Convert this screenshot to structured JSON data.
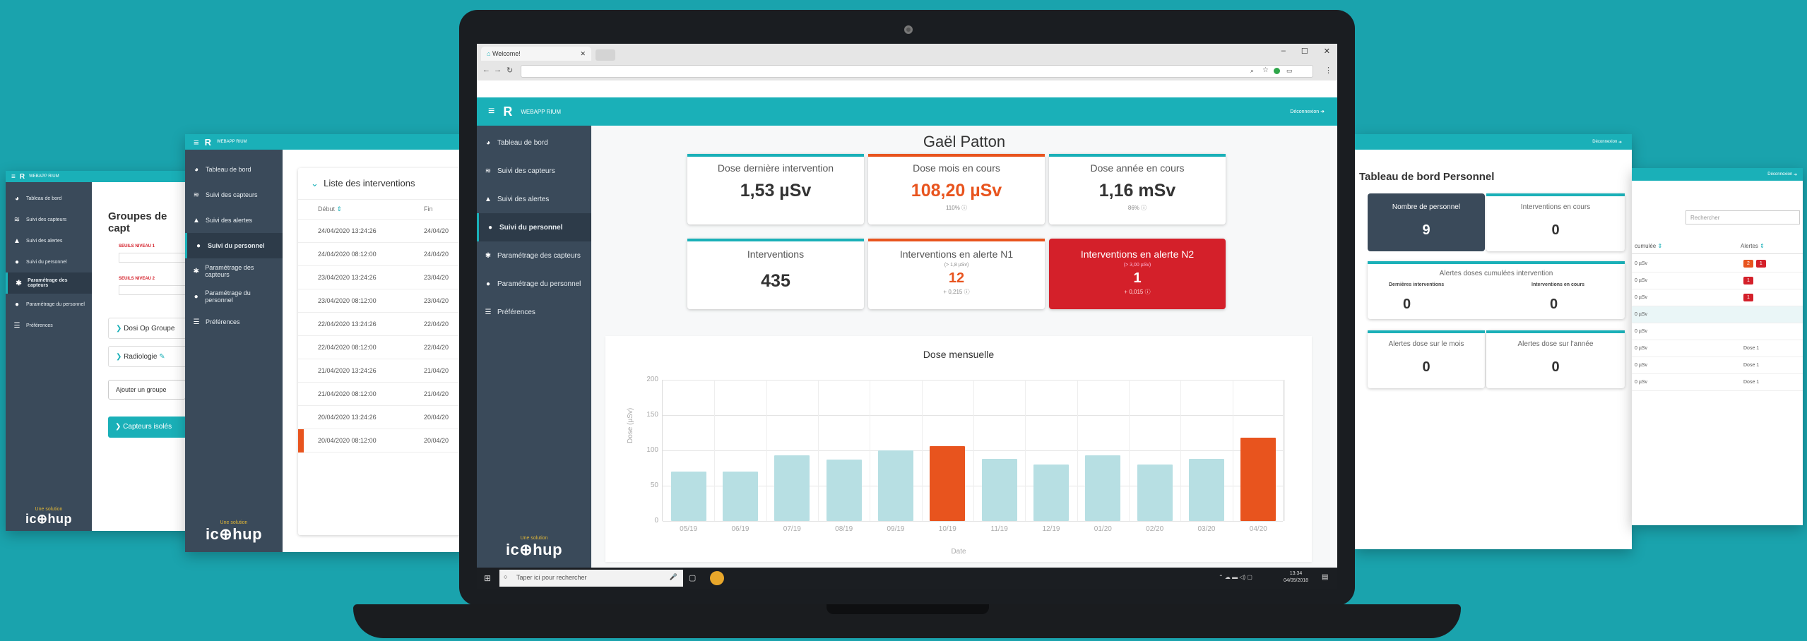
{
  "app": {
    "brand": "WEBAPP RIUM",
    "solution_label": "Une solution",
    "logo_text": "ic⊕hup",
    "logout": "Déconnexion"
  },
  "colors": {
    "teal": "#1ab0b8",
    "sidebar": "#3a4a5a",
    "orange": "#e8541e",
    "red": "#d4202a",
    "light_bar": "#b7dfe3"
  },
  "sidebar": {
    "items": [
      {
        "label": "Tableau de bord",
        "icon": "dashboard-icon"
      },
      {
        "label": "Suivi des capteurs",
        "icon": "wifi-icon"
      },
      {
        "label": "Suivi des alertes",
        "icon": "warning-icon"
      },
      {
        "label": "Suivi du personnel",
        "icon": "people-icon"
      },
      {
        "label": "Paramétrage des capteurs",
        "icon": "settings-icon"
      },
      {
        "label": "Paramétrage du personnel",
        "icon": "people-settings-icon"
      },
      {
        "label": "Préférences",
        "icon": "sliders-icon"
      }
    ]
  },
  "browser": {
    "tab_title": "Welcome!",
    "window_buttons": [
      "–",
      "☐",
      "✕"
    ]
  },
  "taskbar": {
    "search_placeholder": "Taper ici pour rechercher",
    "time": "13:34",
    "date": "04/05/2018"
  },
  "main": {
    "person_name": "Gaël Patton",
    "cards": [
      {
        "title": "Dose dernière intervention",
        "value": "1,53 µSv",
        "sub": ""
      },
      {
        "title": "Dose mois en cours",
        "value": "108,20 µSv",
        "sub": "110%"
      },
      {
        "title": "Dose année en cours",
        "value": "1,16 mSv",
        "sub": "86%"
      },
      {
        "title": "Interventions",
        "value": "435",
        "sub": ""
      },
      {
        "title": "Interventions en alerte N1",
        "note": "(> 1,8 µSv)",
        "value": "12",
        "sub": "+ 0,215"
      },
      {
        "title": "Interventions en alerte N2",
        "note": "(> 3,00 µSv)",
        "value": "1",
        "sub": "+ 0,015"
      }
    ]
  },
  "chart_data": {
    "type": "bar",
    "title": "Dose mensuelle",
    "xlabel": "Date",
    "ylabel": "Dose (µSv)",
    "ylim": [
      0,
      200
    ],
    "yticks": [
      0,
      50,
      100,
      150,
      200
    ],
    "grid": true,
    "categories": [
      "05/19",
      "06/19",
      "07/19",
      "08/19",
      "09/19",
      "10/19",
      "11/19",
      "12/19",
      "01/20",
      "02/20",
      "03/20",
      "04/20"
    ],
    "values": [
      70,
      70,
      93,
      87,
      100,
      106,
      88,
      80,
      93,
      80,
      88,
      118
    ],
    "highlight": [
      "10/19",
      "04/20"
    ]
  },
  "left_panel_1": {
    "heading": "Groupes de capt",
    "fields": [
      "SEUILS NIVEAU 1",
      "SEUILS NIVEAU 2"
    ],
    "groups": [
      "Dosi Op Groupe",
      "Radiologie"
    ],
    "add_button": "Ajouter un groupe",
    "footer_button": "Capteurs isolés"
  },
  "left_panel_2": {
    "heading": "Liste des interventions",
    "columns": [
      "Début",
      "Fin"
    ],
    "rows": [
      [
        "24/04/2020 13:24:26",
        "24/04/20"
      ],
      [
        "24/04/2020 08:12:00",
        "24/04/20"
      ],
      [
        "23/04/2020 13:24:26",
        "23/04/20"
      ],
      [
        "23/04/2020 08:12:00",
        "23/04/20"
      ],
      [
        "22/04/2020 13:24:26",
        "22/04/20"
      ],
      [
        "22/04/2020 08:12:00",
        "22/04/20"
      ],
      [
        "21/04/2020 13:24:26",
        "21/04/20"
      ],
      [
        "21/04/2020 08:12:00",
        "21/04/20"
      ],
      [
        "20/04/2020 13:24:26",
        "20/04/20"
      ],
      [
        "20/04/2020 08:12:00",
        "20/04/20"
      ]
    ]
  },
  "right_panel_1": {
    "heading": "Tableau de bord Personnel",
    "personnel_label": "Nombre de personnel",
    "personnel_value": "9",
    "interventions_label": "Interventions en cours",
    "interventions_value": "0",
    "alerts_title": "Alertes doses cumulées intervention",
    "last_label": "Dernières interventions",
    "last_value": "0",
    "current_label": "Interventions en cours",
    "current_value": "0",
    "month_label": "Alertes dose sur le mois",
    "month_value": "0",
    "year_label": "Alertes dose sur l'année",
    "year_value": "0"
  },
  "right_panel_2": {
    "search_placeholder": "Rechercher",
    "columns": [
      "cumulée",
      "Alertes"
    ],
    "rows": [
      {
        "dose": "0 µSv",
        "a": "2",
        "b": "1",
        "status": ""
      },
      {
        "dose": "0 µSv",
        "a": "",
        "b": "1",
        "status": ""
      },
      {
        "dose": "0 µSv",
        "a": "",
        "b": "1",
        "status": ""
      },
      {
        "dose": "0 µSv",
        "a": "",
        "b": "",
        "status": ""
      },
      {
        "dose": "0 µSv",
        "a": "",
        "b": "",
        "status": ""
      },
      {
        "dose": "0 µSv",
        "a": "",
        "b": "",
        "status": "Dose 1"
      },
      {
        "dose": "0 µSv",
        "a": "",
        "b": "",
        "status": "Dose 1"
      },
      {
        "dose": "0 µSv",
        "a": "",
        "b": "",
        "status": "Dose 1"
      }
    ]
  }
}
